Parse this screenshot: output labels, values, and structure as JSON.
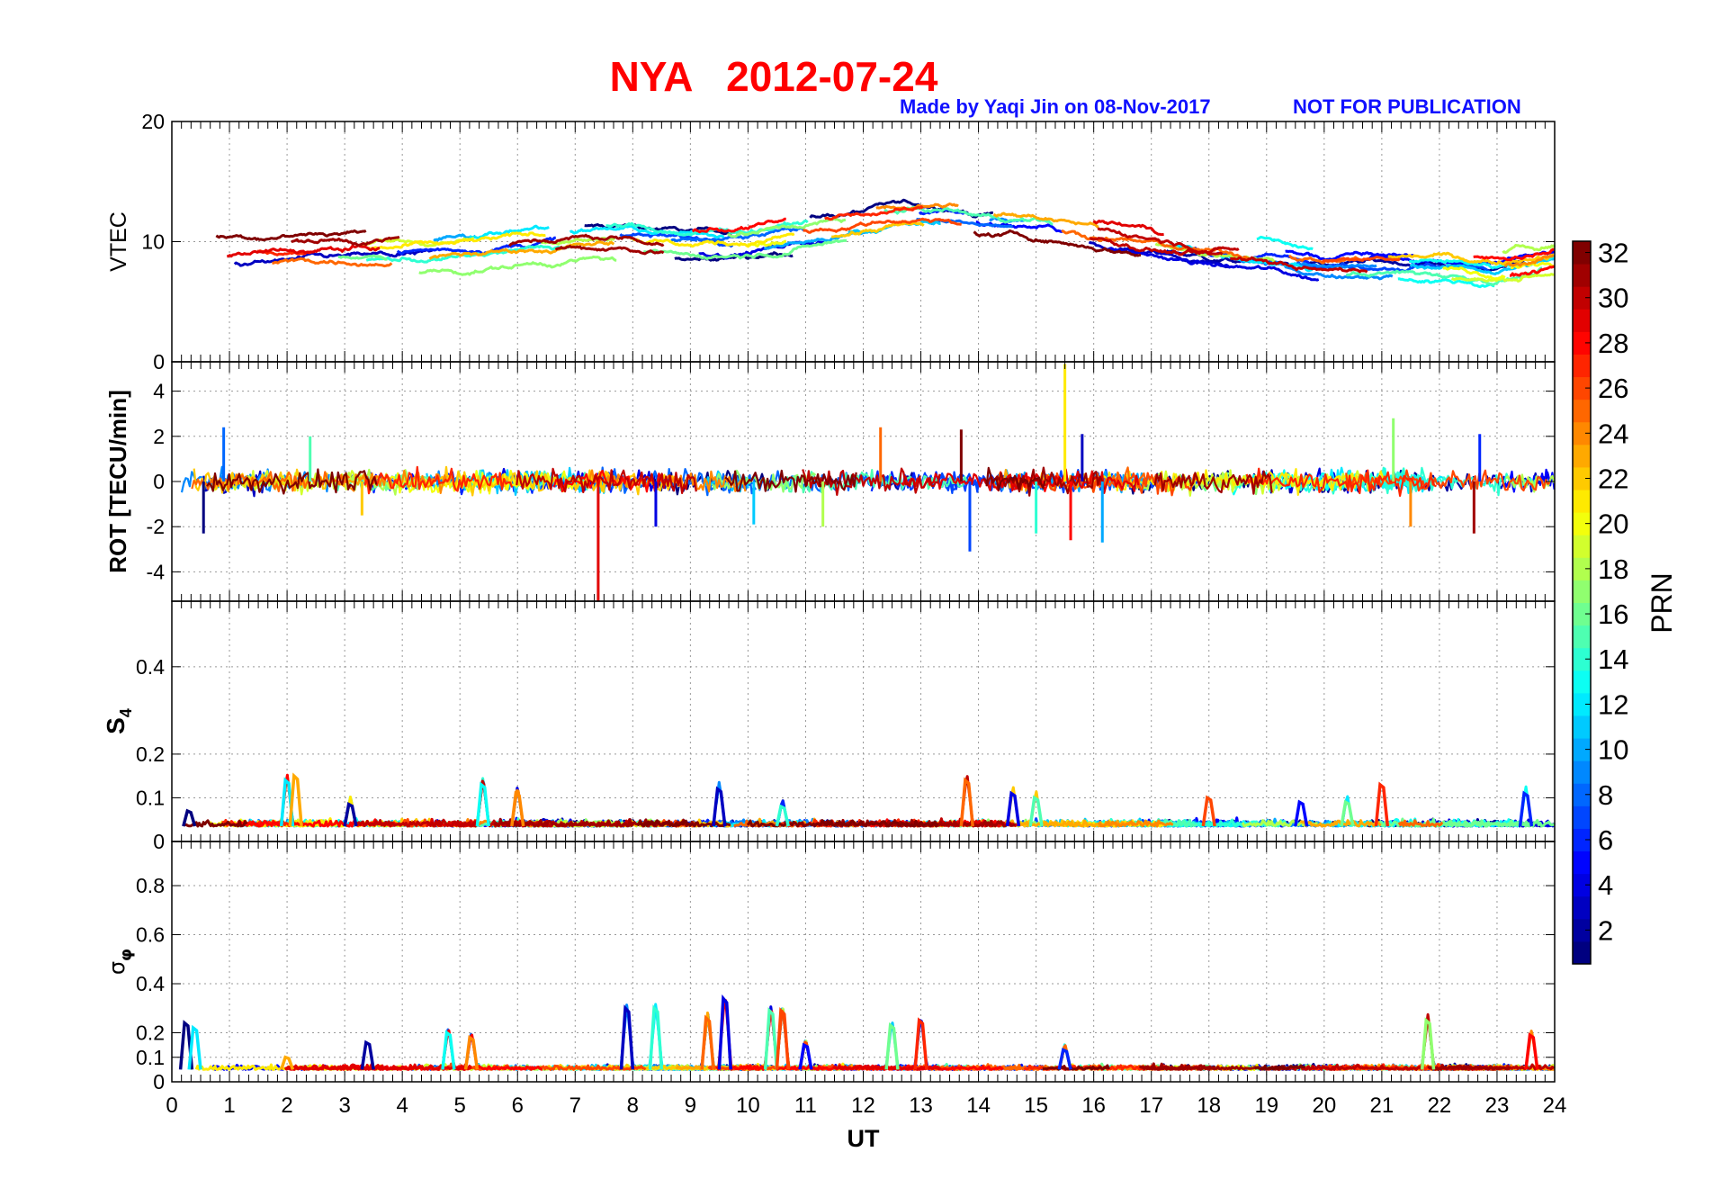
{
  "header": {
    "title": "NYA   2012-07-24",
    "credit": "Made by Yaqi Jin on 08-Nov-2017",
    "notice": "NOT FOR PUBLICATION"
  },
  "colors": {
    "title": "#ff0000",
    "credit": "#1010ff",
    "grid": "#999999",
    "axis": "#000000"
  },
  "chart_data": {
    "type": "line",
    "x_label": "UT",
    "x_range": [
      0,
      24
    ],
    "x_ticks": [
      "0",
      "1",
      "2",
      "3",
      "4",
      "5",
      "6",
      "7",
      "8",
      "9",
      "10",
      "11",
      "12",
      "13",
      "14",
      "15",
      "16",
      "17",
      "18",
      "19",
      "20",
      "21",
      "22",
      "23",
      "24"
    ],
    "grid": true,
    "colormap": "jet",
    "colorbar": {
      "label": "PRN",
      "range": [
        1,
        32
      ],
      "ticks": [
        "2",
        "4",
        "6",
        "8",
        "10",
        "12",
        "14",
        "16",
        "18",
        "20",
        "22",
        "24",
        "26",
        "28",
        "30",
        "32"
      ],
      "placement": "right"
    },
    "panels": [
      {
        "id": "vtec",
        "ylabel": "VTEC",
        "ylim": [
          0,
          20
        ],
        "yticks": [
          "0",
          "10",
          "20"
        ],
        "trend_x": [
          0,
          1,
          2,
          3,
          4,
          5,
          6,
          7,
          8,
          9,
          10,
          11,
          12,
          12.5,
          13,
          13.5,
          14,
          15,
          16,
          17,
          18,
          19,
          20,
          21,
          22,
          23,
          24
        ],
        "trend_y": [
          9.0,
          8.8,
          9.0,
          9.2,
          9.3,
          9.5,
          10.0,
          10.5,
          10.5,
          10.0,
          10.3,
          11.0,
          11.6,
          12.0,
          12.0,
          12.0,
          11.5,
          11.2,
          10.5,
          9.8,
          9.0,
          8.6,
          7.8,
          8.0,
          8.0,
          7.6,
          8.5
        ],
        "spread": 1.6,
        "min_val": 5.5,
        "max_val": 15.0
      },
      {
        "id": "rot",
        "ylabel": "ROT [TECU/min]",
        "ylim": [
          -5.3,
          5.3
        ],
        "yticks": [
          "-4",
          "-2",
          "0",
          "2",
          "4"
        ],
        "noise": 0.45,
        "spikes": [
          {
            "x": 0.55,
            "y": -2.3
          },
          {
            "x": 0.9,
            "y": 2.4
          },
          {
            "x": 2.4,
            "y": 2.0
          },
          {
            "x": 3.3,
            "y": -1.5
          },
          {
            "x": 7.4,
            "y": -5.3
          },
          {
            "x": 8.4,
            "y": -2.0
          },
          {
            "x": 10.1,
            "y": -1.9
          },
          {
            "x": 11.3,
            "y": -2.0
          },
          {
            "x": 12.3,
            "y": 2.4
          },
          {
            "x": 13.7,
            "y": 2.3
          },
          {
            "x": 13.85,
            "y": -3.1
          },
          {
            "x": 15.0,
            "y": -2.3
          },
          {
            "x": 15.5,
            "y": 5.2
          },
          {
            "x": 15.6,
            "y": -2.6
          },
          {
            "x": 15.8,
            "y": 2.1
          },
          {
            "x": 16.15,
            "y": -2.7
          },
          {
            "x": 21.2,
            "y": 2.8
          },
          {
            "x": 21.5,
            "y": -2.0
          },
          {
            "x": 22.6,
            "y": -2.3
          },
          {
            "x": 22.7,
            "y": 2.1
          }
        ]
      },
      {
        "id": "s4",
        "ylabel": "S4",
        "ylim": [
          0,
          0.55
        ],
        "yticks": [
          "0",
          "0.1",
          "0.2",
          "0.4"
        ],
        "base": 0.035,
        "noise": 0.012,
        "bumps": [
          {
            "x": 0.3,
            "h": 0.07
          },
          {
            "x": 2.0,
            "h": 0.14
          },
          {
            "x": 2.15,
            "h": 0.15
          },
          {
            "x": 3.1,
            "h": 0.085
          },
          {
            "x": 5.4,
            "h": 0.13
          },
          {
            "x": 6.0,
            "h": 0.11
          },
          {
            "x": 9.5,
            "h": 0.12
          },
          {
            "x": 10.6,
            "h": 0.08
          },
          {
            "x": 13.8,
            "h": 0.14
          },
          {
            "x": 14.6,
            "h": 0.11
          },
          {
            "x": 15.0,
            "h": 0.1
          },
          {
            "x": 18.0,
            "h": 0.1
          },
          {
            "x": 19.6,
            "h": 0.09
          },
          {
            "x": 20.4,
            "h": 0.09
          },
          {
            "x": 21.0,
            "h": 0.13
          },
          {
            "x": 23.5,
            "h": 0.11
          }
        ]
      },
      {
        "id": "sigphi",
        "ylabel": "σφ",
        "ylim": [
          0,
          0.98
        ],
        "yticks": [
          "0",
          "0.1",
          "0.2",
          "0.4",
          "0.6",
          "0.8"
        ],
        "base": 0.05,
        "noise": 0.015,
        "bumps": [
          {
            "x": 0.25,
            "h": 0.24
          },
          {
            "x": 0.4,
            "h": 0.22
          },
          {
            "x": 2.0,
            "h": 0.1
          },
          {
            "x": 3.4,
            "h": 0.16
          },
          {
            "x": 4.8,
            "h": 0.2
          },
          {
            "x": 5.2,
            "h": 0.18
          },
          {
            "x": 7.9,
            "h": 0.3
          },
          {
            "x": 8.4,
            "h": 0.3
          },
          {
            "x": 9.3,
            "h": 0.26
          },
          {
            "x": 9.6,
            "h": 0.34
          },
          {
            "x": 10.4,
            "h": 0.29
          },
          {
            "x": 10.6,
            "h": 0.29
          },
          {
            "x": 11.0,
            "h": 0.15
          },
          {
            "x": 12.5,
            "h": 0.23
          },
          {
            "x": 13.0,
            "h": 0.25
          },
          {
            "x": 15.5,
            "h": 0.13
          },
          {
            "x": 21.8,
            "h": 0.25
          },
          {
            "x": 23.6,
            "h": 0.19
          }
        ]
      }
    ]
  }
}
